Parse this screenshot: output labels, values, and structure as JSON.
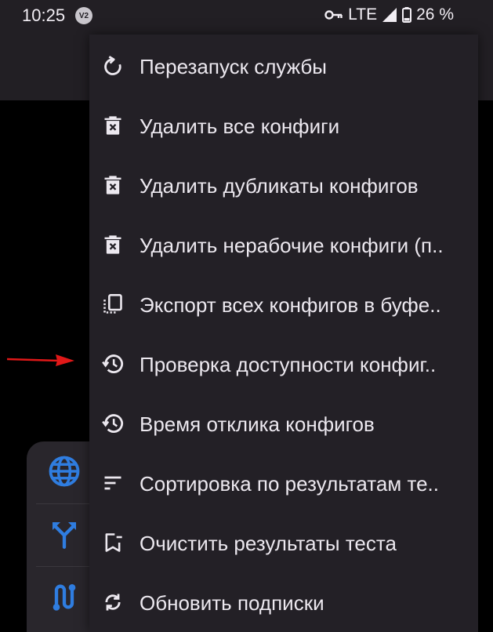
{
  "status_bar": {
    "time": "10:25",
    "app_badge": "V2",
    "network": "LTE",
    "battery": "26 %"
  },
  "menu": {
    "items": [
      {
        "label": "Перезапуск службы",
        "icon": "restart-icon"
      },
      {
        "label": "Удалить все конфиги",
        "icon": "trash-icon"
      },
      {
        "label": "Удалить дубликаты конфигов",
        "icon": "trash-icon"
      },
      {
        "label": "Удалить нерабочие конфиги (п..",
        "icon": "trash-icon"
      },
      {
        "label": "Экспорт всех конфигов в буфе..",
        "icon": "copy-icon"
      },
      {
        "label": "Проверка доступности конфиг..",
        "icon": "history-icon"
      },
      {
        "label": "Время отклика конфигов",
        "icon": "history-icon"
      },
      {
        "label": "Сортировка по результатам те..",
        "icon": "sort-icon"
      },
      {
        "label": "Очистить результаты теста",
        "icon": "bookmark-remove-icon"
      },
      {
        "label": "Обновить подписки",
        "icon": "sync-icon"
      }
    ]
  },
  "side_rail": {
    "items": [
      {
        "icon": "globe-icon"
      },
      {
        "icon": "split-routing-icon"
      },
      {
        "icon": "route-icon"
      }
    ]
  },
  "colors": {
    "menu_background": "#232026",
    "accent_blue": "#2f7de0",
    "arrow_red": "#e01818"
  }
}
